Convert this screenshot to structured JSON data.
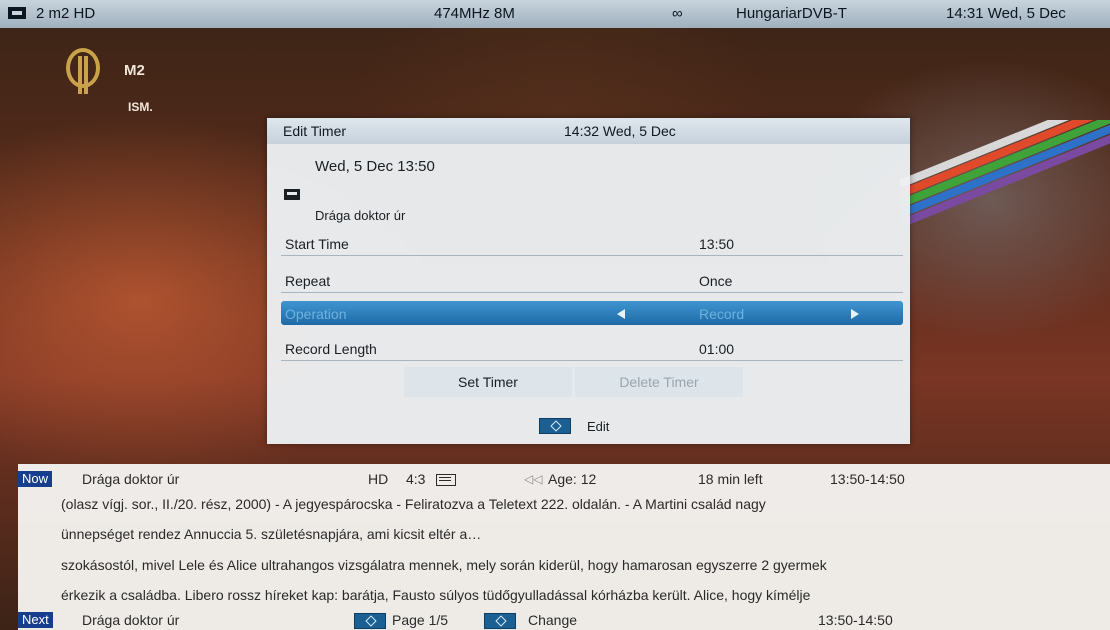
{
  "topbar": {
    "channel": "2 m2 HD",
    "frequency": "474MHz 8M",
    "network": "HungariarDVB-T",
    "datetime": "14:31 Wed, 5 Dec"
  },
  "logo": {
    "name": "M2",
    "sub": "ISM."
  },
  "dialog": {
    "title": "Edit Timer",
    "time": "14:32 Wed, 5 Dec",
    "program_date": "Wed, 5 Dec 13:50",
    "program_name": "Drága doktor úr",
    "rows": [
      {
        "label": "Start Time",
        "value": "13:50"
      },
      {
        "label": "Repeat",
        "value": "Once"
      },
      {
        "label": "Operation",
        "value": "Record"
      },
      {
        "label": "Record Length",
        "value": "01:00"
      }
    ],
    "set_timer": "Set Timer",
    "delete_timer": "Delete Timer",
    "footer_edit": "Edit"
  },
  "info": {
    "now_tag": "Now",
    "now_title": "Drága doktor úr",
    "hd": "HD",
    "aspect": "4:3",
    "age": "Age: 12",
    "left": "18 min left",
    "time_range": "13:50-14:50",
    "lines": [
      "(olasz vígj. sor., II./20. rész, 2000) - A jegyespárocska - Feliratozva a Teletext 222. oldalán.  - A Martini család nagy",
      "ünnepséget rendez Annuccia 5. születésnapjára, ami kicsit eltér a…",
      "szokásostól, mivel Lele és Alice ultrahangos vizsgálatra mennek, mely során kiderül, hogy hamarosan egyszerre 2 gyermek",
      "érkezik a családba. Libero rossz híreket kap: barátja, Fausto súlyos tüdőgyulladással kórházba került. Alice, hogy kímélje"
    ],
    "next_tag": "Next",
    "next_title": "Drága doktor úr",
    "page": "Page 1/5",
    "change": "Change",
    "next_time": "13:50-14:50"
  },
  "colors": {
    "selection": "#2a7fbe",
    "tag": "#173e8c",
    "topbar": "#b7c5d0"
  }
}
